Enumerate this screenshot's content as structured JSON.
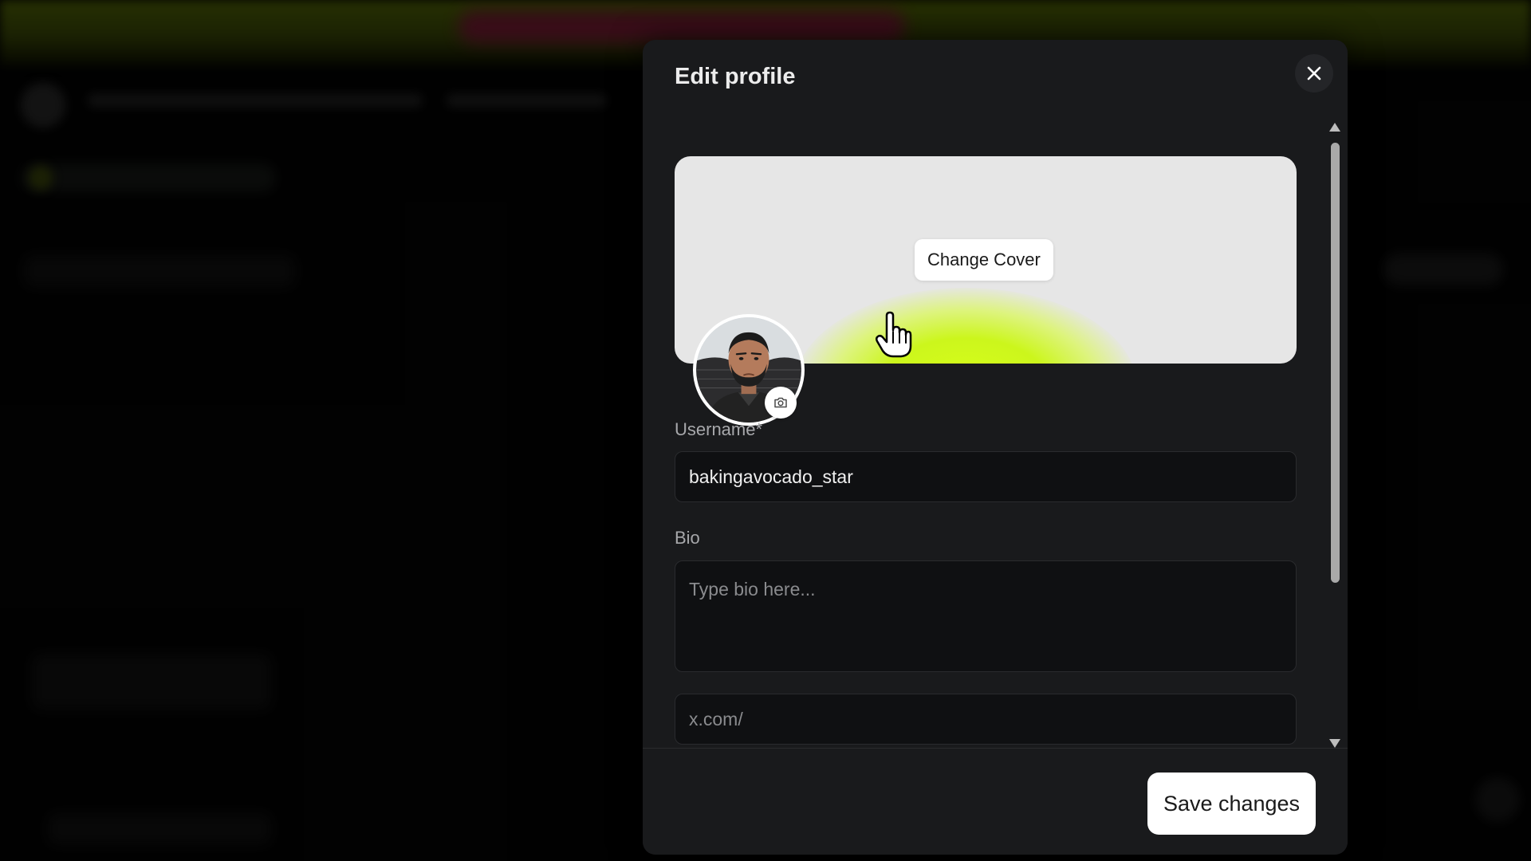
{
  "modal": {
    "title": "Edit profile",
    "close_icon": "close-icon"
  },
  "cover": {
    "change_label": "Change Cover",
    "accent_color": "#d8ff1a"
  },
  "avatar": {
    "edit_icon": "camera-icon"
  },
  "form": {
    "username": {
      "label": "Username*",
      "value": "bakingavocado_star"
    },
    "bio": {
      "label": "Bio",
      "placeholder": "Type bio here..."
    },
    "x_link": {
      "placeholder": "x.com/"
    }
  },
  "footer": {
    "save_label": "Save changes"
  },
  "colors": {
    "modal_bg": "#191a1c",
    "input_bg": "#0f1012",
    "brand_lime": "#d8ff1a"
  }
}
